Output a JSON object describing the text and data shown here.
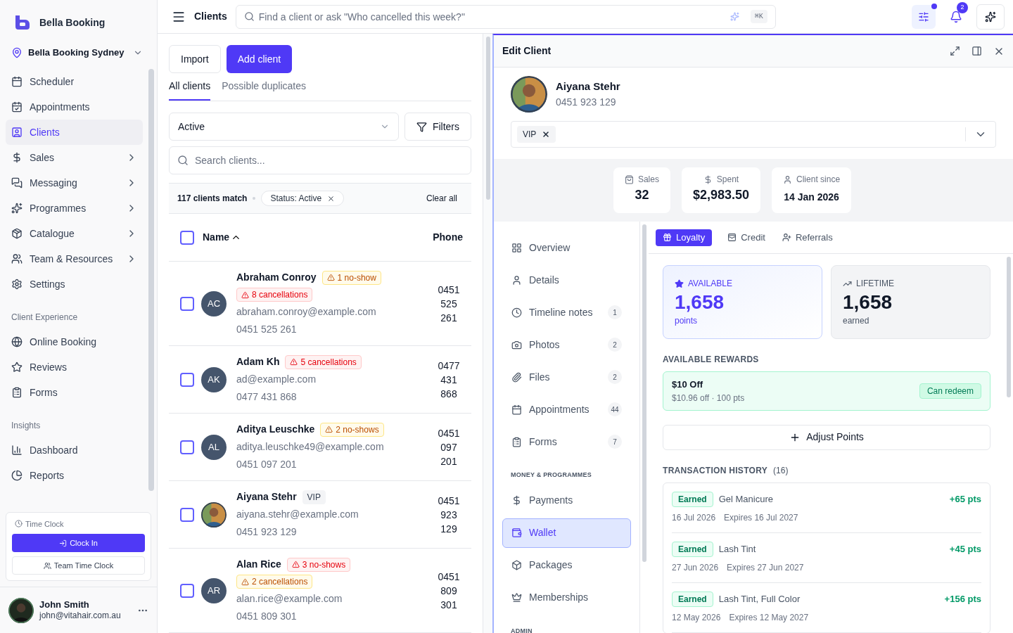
{
  "sidebar": {
    "brand": "Bella Booking",
    "location": "Bella Booking Sydney",
    "groups": [
      {
        "items": [
          {
            "label": "Scheduler",
            "selected": false,
            "expandable": false
          },
          {
            "label": "Appointments",
            "selected": false,
            "expandable": false
          },
          {
            "label": "Clients",
            "selected": true,
            "expandable": false
          },
          {
            "label": "Sales",
            "selected": false,
            "expandable": true
          },
          {
            "label": "Messaging",
            "selected": false,
            "expandable": true
          },
          {
            "label": "Programmes",
            "selected": false,
            "expandable": true
          },
          {
            "label": "Catalogue",
            "selected": false,
            "expandable": true
          },
          {
            "label": "Team & Resources",
            "selected": false,
            "expandable": true
          },
          {
            "label": "Settings",
            "selected": false,
            "expandable": false
          }
        ]
      },
      {
        "heading": "Client Experience",
        "items": [
          {
            "label": "Online Booking",
            "selected": false,
            "expandable": false
          },
          {
            "label": "Reviews",
            "selected": false,
            "expandable": false
          },
          {
            "label": "Forms",
            "selected": false,
            "expandable": false
          }
        ]
      },
      {
        "heading": "Insights",
        "items": [
          {
            "label": "Dashboard",
            "selected": false,
            "expandable": false
          },
          {
            "label": "Reports",
            "selected": false,
            "expandable": false
          }
        ]
      }
    ],
    "time_clock": {
      "title": "Time Clock",
      "primary": "Clock In",
      "secondary": "Team Time Clock"
    },
    "user": {
      "name": "John Smith",
      "email": "john@vitahair.com.au"
    }
  },
  "topbar": {
    "title": "Clients",
    "search_placeholder": "Find a client or ask \"Who cancelled this week?\"",
    "shortcut": "⌘K",
    "filters_indicator": true,
    "notification_count": "2"
  },
  "clients": {
    "buttons": [
      {
        "label": "Import",
        "kind": "secondary"
      },
      {
        "label": "Add client",
        "kind": "primary"
      }
    ],
    "tabs": [
      {
        "label": "All clients",
        "selected": true
      },
      {
        "label": "Possible duplicates",
        "selected": false
      }
    ],
    "status_select": "Active",
    "filters_button": "Filters",
    "search_placeholder": "Search clients...",
    "match_count": "117 clients match",
    "filter_chip": "Status: Active",
    "clear_all": "Clear all",
    "select_all_checked": false,
    "columns": [
      "Name",
      "Phone"
    ],
    "rows": [
      {
        "name": "Abraham Conroy",
        "initials": "AC",
        "checked": false,
        "tags": [
          {
            "text": "1 no-show",
            "kind": "warning"
          },
          {
            "text": "8 cancellations",
            "kind": "danger"
          }
        ],
        "email": "abraham.conroy@example.com",
        "phone": "0451 525 261",
        "phone_column": "0451 525 261"
      },
      {
        "name": "Adam Kh",
        "initials": "AK",
        "checked": false,
        "tags": [
          {
            "text": "5 cancellations",
            "kind": "danger"
          }
        ],
        "email": "ad@example.com",
        "phone": "0477 431 868",
        "phone_column": "0477 431 868"
      },
      {
        "name": "Aditya Leuschke",
        "initials": "AL",
        "checked": false,
        "tags": [
          {
            "text": "2 no-shows",
            "kind": "warning"
          }
        ],
        "email": "aditya.leuschke49@example.com",
        "phone": "0451 097 201",
        "phone_column": "0451 097 201"
      },
      {
        "name": "Aiyana Stehr",
        "checked": false,
        "tags": [
          {
            "text": "VIP",
            "kind": "neutral"
          }
        ],
        "email": "aiyana.stehr@example.com",
        "phone": "0451 923 129",
        "phone_column": "0451 923 129"
      },
      {
        "name": "Alan Rice",
        "initials": "AR",
        "checked": false,
        "tags": [
          {
            "text": "3 no-shows",
            "kind": "danger"
          },
          {
            "text": "2 cancellations",
            "kind": "warning"
          }
        ],
        "email": "alan.rice@example.com",
        "phone": "0451 809 301",
        "phone_column": "0451 809 301"
      }
    ]
  },
  "edit_client": {
    "title": "Edit Client",
    "name": "Aiyana Stehr",
    "phone": "0451 923 129",
    "tags": [
      "VIP"
    ],
    "stats": [
      {
        "label": "Sales",
        "value": "32"
      },
      {
        "label": "Spent",
        "value": "$2,983.50"
      },
      {
        "label": "Client since",
        "value": "14 Jan 2026"
      }
    ],
    "nav": [
      {
        "items": [
          {
            "label": "Overview",
            "selected": false
          },
          {
            "label": "Details",
            "selected": false
          },
          {
            "label": "Timeline notes",
            "count": "1",
            "selected": false
          },
          {
            "label": "Photos",
            "count": "2",
            "selected": false
          },
          {
            "label": "Files",
            "count": "2",
            "selected": false
          },
          {
            "label": "Appointments",
            "count": "44",
            "selected": false
          },
          {
            "label": "Forms",
            "count": "7",
            "selected": false
          }
        ]
      },
      {
        "heading": "MONEY & PROGRAMMES",
        "items": [
          {
            "label": "Payments",
            "selected": false
          },
          {
            "label": "Wallet",
            "selected": true
          },
          {
            "label": "Packages",
            "selected": false
          },
          {
            "label": "Memberships",
            "selected": false
          }
        ]
      },
      {
        "heading": "ADMIN"
      }
    ],
    "wallet_tabs": [
      {
        "label": "Loyalty",
        "selected": true
      },
      {
        "label": "Credit",
        "selected": false
      },
      {
        "label": "Referrals",
        "selected": false
      }
    ],
    "available": {
      "label": "AVAILABLE",
      "value": "1,658",
      "unit": "points"
    },
    "lifetime": {
      "label": "LIFETIME",
      "value": "1,658",
      "unit": "earned"
    },
    "rewards_heading": "AVAILABLE REWARDS",
    "rewards": [
      {
        "title": "$10 Off",
        "detail": "$10.96 off · 100 pts",
        "status": "Can redeem"
      }
    ],
    "adjust_button": "Adjust Points",
    "history_heading": "TRANSACTION HISTORY",
    "history_count": "(16)",
    "transactions": [
      {
        "type": "Earned",
        "name": "Gel Manicure",
        "points": "+65 pts",
        "date": "16 Jul 2026",
        "expires": "Expires 16 Jul 2027"
      },
      {
        "type": "Earned",
        "name": "Lash Tint",
        "points": "+45 pts",
        "date": "27 Jun 2026",
        "expires": "Expires 27 Jun 2027"
      },
      {
        "type": "Earned",
        "name": "Lash Tint, Full Color",
        "points": "+156 pts",
        "date": "12 May 2026",
        "expires": "Expires 12 May 2027"
      }
    ]
  }
}
